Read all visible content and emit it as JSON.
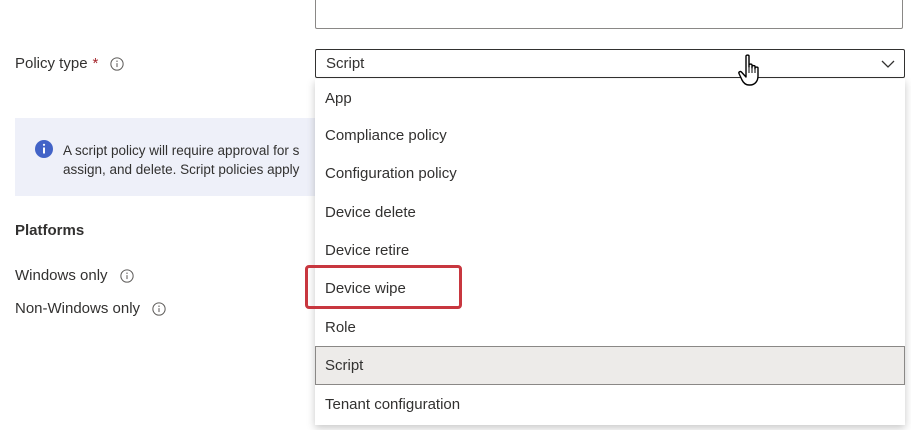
{
  "form": {
    "policy_type_label": "Policy type",
    "required_marker": "*",
    "selected_value": "Script",
    "banner_line1": "A script policy will require approval for s",
    "banner_line2": "assign, and delete. Script policies apply",
    "platforms_heading": "Platforms",
    "platform_windows": "Windows only",
    "platform_non_windows": "Non-Windows only"
  },
  "dropdown": {
    "options": [
      "App",
      "Compliance policy",
      "Configuration policy",
      "Device delete",
      "Device retire",
      "Device wipe",
      "Role",
      "Script",
      "Tenant configuration"
    ],
    "highlighted_option": "Device wipe"
  },
  "colors": {
    "accent_info": "#4263c7",
    "required": "#a4262c",
    "highlight_box": "#c8373f",
    "selected_bg": "#edebe9"
  },
  "icons": [
    "info-icon",
    "chevron-down-icon",
    "hand-pointer-cursor",
    "info-circle-filled-icon"
  ]
}
